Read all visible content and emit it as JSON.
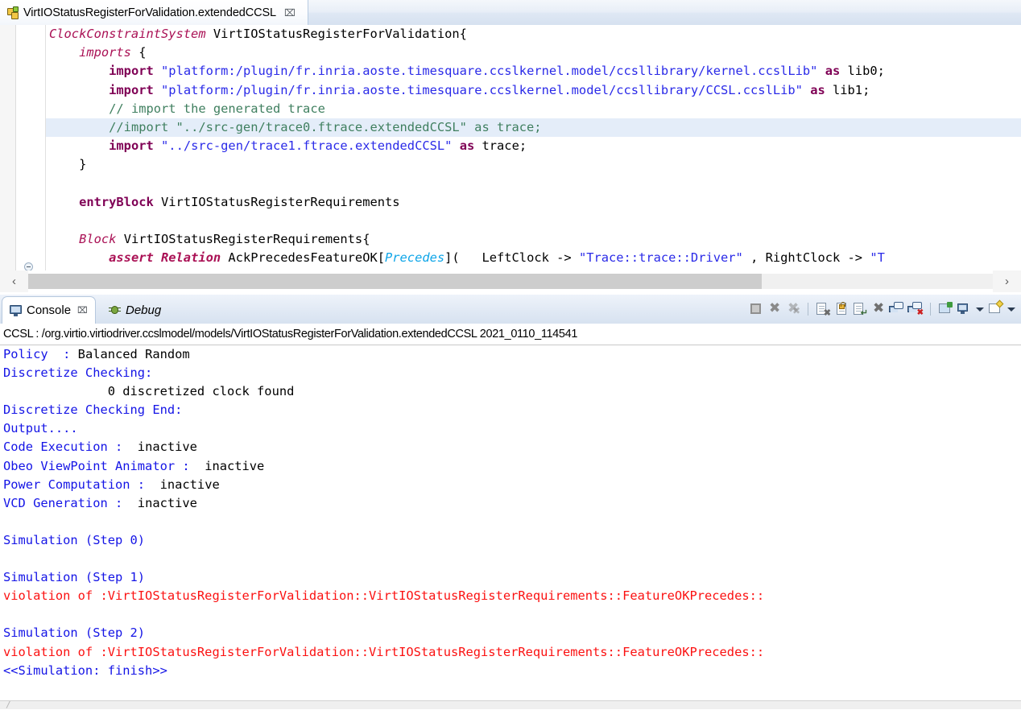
{
  "editor": {
    "tab": {
      "icon": "ccsl-model-icon",
      "title": "VirtIOStatusRegisterForValidation.extendedCCSL",
      "close": "⌧"
    },
    "code_lines": [
      {
        "indent": 0,
        "tokens": [
          {
            "t": "ClockConstraintSystem ",
            "c": "kwi"
          },
          {
            "t": "VirtIOStatusRegisterForValidation{",
            "c": ""
          }
        ]
      },
      {
        "indent": 0,
        "tokens": [
          {
            "t": "    ",
            "c": ""
          },
          {
            "t": "imports",
            "c": "kwi"
          },
          {
            "t": " {",
            "c": ""
          }
        ]
      },
      {
        "indent": 0,
        "tokens": [
          {
            "t": "        ",
            "c": ""
          },
          {
            "t": "import",
            "c": "kw"
          },
          {
            "t": " ",
            "c": ""
          },
          {
            "t": "\"platform:/plugin/fr.inria.aoste.timesquare.ccslkernel.model/ccsllibrary/kernel.ccslLib\"",
            "c": "str"
          },
          {
            "t": " ",
            "c": ""
          },
          {
            "t": "as",
            "c": "kw"
          },
          {
            "t": " lib0;",
            "c": ""
          }
        ]
      },
      {
        "indent": 0,
        "tokens": [
          {
            "t": "        ",
            "c": ""
          },
          {
            "t": "import",
            "c": "kw"
          },
          {
            "t": " ",
            "c": ""
          },
          {
            "t": "\"platform:/plugin/fr.inria.aoste.timesquare.ccslkernel.model/ccsllibrary/CCSL.ccslLib\"",
            "c": "str"
          },
          {
            "t": " ",
            "c": ""
          },
          {
            "t": "as",
            "c": "kw"
          },
          {
            "t": " lib1;",
            "c": ""
          }
        ]
      },
      {
        "indent": 0,
        "tokens": [
          {
            "t": "        ",
            "c": ""
          },
          {
            "t": "// import the generated trace",
            "c": "cmt"
          }
        ]
      },
      {
        "indent": 0,
        "highlight": true,
        "tokens": [
          {
            "t": "        ",
            "c": ""
          },
          {
            "t": "//import \"../src-gen/trace0.ftrace.extendedCCSL\" as trace;",
            "c": "cmt"
          }
        ]
      },
      {
        "indent": 0,
        "tokens": [
          {
            "t": "        ",
            "c": ""
          },
          {
            "t": "import",
            "c": "kw"
          },
          {
            "t": " ",
            "c": ""
          },
          {
            "t": "\"../src-gen/trace1.ftrace.extendedCCSL\"",
            "c": "str"
          },
          {
            "t": " ",
            "c": ""
          },
          {
            "t": "as",
            "c": "kw"
          },
          {
            "t": " trace;",
            "c": ""
          }
        ]
      },
      {
        "indent": 0,
        "tokens": [
          {
            "t": "    }",
            "c": ""
          }
        ]
      },
      {
        "indent": 0,
        "tokens": [
          {
            "t": "",
            "c": ""
          }
        ]
      },
      {
        "indent": 0,
        "tokens": [
          {
            "t": "    ",
            "c": ""
          },
          {
            "t": "entryBlock",
            "c": "kw"
          },
          {
            "t": " VirtIOStatusRegisterRequirements",
            "c": ""
          }
        ]
      },
      {
        "indent": 0,
        "tokens": [
          {
            "t": "",
            "c": ""
          }
        ]
      },
      {
        "indent": 0,
        "fold": true,
        "tokens": [
          {
            "t": "    ",
            "c": ""
          },
          {
            "t": "Block",
            "c": "kwi"
          },
          {
            "t": " VirtIOStatusRegisterRequirements{",
            "c": ""
          }
        ]
      },
      {
        "indent": 0,
        "tokens": [
          {
            "t": "        ",
            "c": ""
          },
          {
            "t": "assert Relation",
            "c": "kwib"
          },
          {
            "t": " AckPrecedesFeatureOK[",
            "c": ""
          },
          {
            "t": "Precedes",
            "c": "typ"
          },
          {
            "t": "](   LeftClock -> ",
            "c": ""
          },
          {
            "t": "\"Trace::trace::Driver\"",
            "c": "str"
          },
          {
            "t": " , RightClock -> ",
            "c": ""
          },
          {
            "t": "\"T",
            "c": "str"
          }
        ]
      }
    ],
    "hscrollbar": {
      "left_arrow": "‹",
      "right_arrow": "›"
    }
  },
  "console": {
    "tabs": [
      {
        "label": "Console",
        "icon": "console-monitor-icon",
        "active": true,
        "closable": true,
        "close": "⌧",
        "italic": false
      },
      {
        "label": "Debug",
        "icon": "debug-bug-icon",
        "active": false,
        "closable": false,
        "close": "",
        "italic": true
      }
    ],
    "toolbar": [
      {
        "name": "terminate-button",
        "kind": "stop"
      },
      {
        "name": "remove-launch-button",
        "kind": "x-light"
      },
      {
        "name": "remove-all-terminated-button",
        "kind": "xx-light"
      },
      {
        "name": "separator-1",
        "kind": "sep"
      },
      {
        "name": "clear-console-button",
        "kind": "doc-x"
      },
      {
        "name": "scroll-lock-button",
        "kind": "lock"
      },
      {
        "name": "word-wrap-button",
        "kind": "doc-wrap"
      },
      {
        "name": "close-console-button",
        "kind": "x-dark"
      },
      {
        "name": "display-selected-console-button",
        "kind": "console-bubble"
      },
      {
        "name": "remove-console-button",
        "kind": "console-bubble-x"
      },
      {
        "name": "separator-2",
        "kind": "sep"
      },
      {
        "name": "pin-console-button",
        "kind": "pin"
      },
      {
        "name": "display-console-button",
        "kind": "monitor"
      },
      {
        "name": "display-console-dropdown",
        "kind": "arrow"
      },
      {
        "name": "open-console-button",
        "kind": "new-console"
      },
      {
        "name": "open-console-dropdown",
        "kind": "arrow"
      }
    ],
    "header": "CCSL : /org.virtio.virtiodriver.ccslmodel/models/VirtIOStatusRegisterForValidation.extendedCCSL 2021_0110_114541",
    "output": [
      [
        {
          "t": "Policy  : ",
          "c": "c-blue"
        },
        {
          "t": "Balanced Random",
          "c": "c-black"
        }
      ],
      [
        {
          "t": "Discretize Checking:",
          "c": "c-blue"
        }
      ],
      [
        {
          "t": "              0 discretized clock found",
          "c": "c-black"
        }
      ],
      [
        {
          "t": "Discretize Checking End:",
          "c": "c-blue"
        }
      ],
      [
        {
          "t": "Output....",
          "c": "c-blue"
        }
      ],
      [
        {
          "t": "Code Execution : ",
          "c": "c-blue"
        },
        {
          "t": " inactive",
          "c": "c-black"
        }
      ],
      [
        {
          "t": "Obeo ViewPoint Animator : ",
          "c": "c-blue"
        },
        {
          "t": " inactive",
          "c": "c-black"
        }
      ],
      [
        {
          "t": "Power Computation : ",
          "c": "c-blue"
        },
        {
          "t": " inactive",
          "c": "c-black"
        }
      ],
      [
        {
          "t": "VCD Generation : ",
          "c": "c-blue"
        },
        {
          "t": " inactive",
          "c": "c-black"
        }
      ],
      [
        {
          "t": "",
          "c": "c-blue"
        }
      ],
      [
        {
          "t": "Simulation (Step 0)",
          "c": "c-blue"
        }
      ],
      [
        {
          "t": "",
          "c": "c-blue"
        }
      ],
      [
        {
          "t": "Simulation (Step 1)",
          "c": "c-blue"
        }
      ],
      [
        {
          "t": "violation of :VirtIOStatusRegisterForValidation::VirtIOStatusRegisterRequirements::FeatureOKPrecedes::",
          "c": "c-red"
        }
      ],
      [
        {
          "t": "",
          "c": "c-blue"
        }
      ],
      [
        {
          "t": "Simulation (Step 2)",
          "c": "c-blue"
        }
      ],
      [
        {
          "t": "violation of :VirtIOStatusRegisterForValidation::VirtIOStatusRegisterRequirements::FeatureOKPrecedes::",
          "c": "c-red"
        }
      ],
      [
        {
          "t": "<<Simulation: finish>>",
          "c": "c-blue"
        }
      ]
    ],
    "footer_mark": "/"
  },
  "colors": {
    "keyword": "#7f0055",
    "string": "#2a2ae8",
    "comment": "#3f7f5f",
    "type": "#0ea5e8",
    "console_info": "#1414e6",
    "console_error": "#fb1111",
    "highlight_line": "#e4edf9",
    "tab_gradient_top": "#f4f7fb",
    "tab_gradient_bottom": "#d6e1f0"
  }
}
